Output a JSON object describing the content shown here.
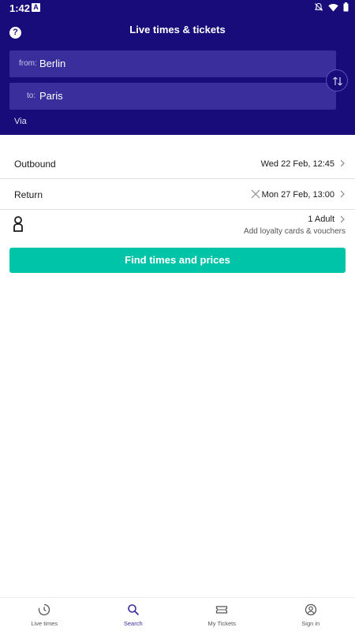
{
  "status_bar": {
    "time": "1:42",
    "notification_badge": "A",
    "icons": [
      "silent-icon",
      "wifi-icon",
      "battery-icon"
    ]
  },
  "header": {
    "title": "Live times & tickets",
    "help_icon": "?",
    "from": {
      "prefix": "from:",
      "value": "Berlin"
    },
    "to": {
      "prefix": "to:",
      "value": "Paris"
    },
    "via_label": "Via",
    "background_color": "#170c7a"
  },
  "journey": {
    "outbound": {
      "label": "Outbound",
      "value": "Wed 22 Feb, 12:45"
    },
    "return": {
      "label": "Return",
      "value": "Mon 27 Feb, 13:00"
    }
  },
  "passengers": {
    "summary": "1 Adult",
    "loyalty_link": "Add loyalty cards & vouchers"
  },
  "find_button": {
    "label": "Find times and prices",
    "color": "#00c4a7"
  },
  "bottom_nav": {
    "items": [
      {
        "label": "Live times",
        "icon": "clock-icon"
      },
      {
        "label": "Search",
        "icon": "search-icon",
        "active": true
      },
      {
        "label": "My Tickets",
        "icon": "ticket-icon"
      },
      {
        "label": "Sign in",
        "icon": "account-icon"
      }
    ],
    "active_color": "#3a2e9c"
  }
}
